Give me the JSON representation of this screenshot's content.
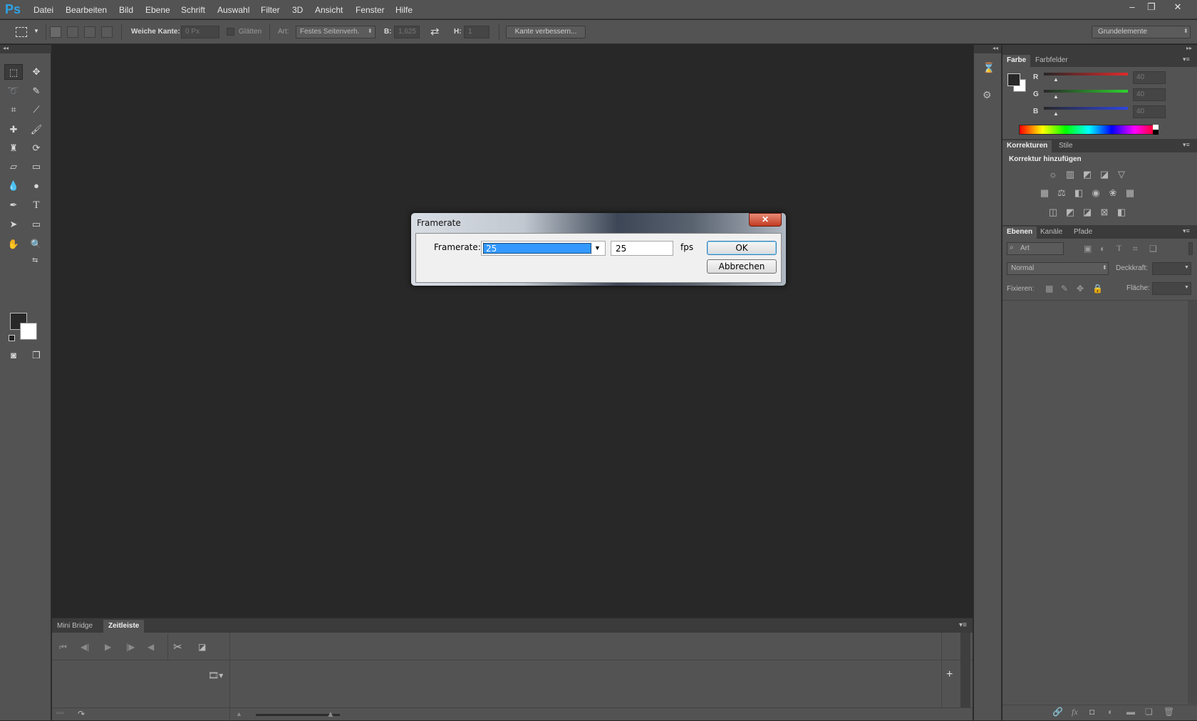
{
  "app": {
    "logo": "Ps"
  },
  "menu": [
    "Datei",
    "Bearbeiten",
    "Bild",
    "Ebene",
    "Schrift",
    "Auswahl",
    "Filter",
    "3D",
    "Ansicht",
    "Fenster",
    "Hilfe"
  ],
  "window_controls": {
    "minimize": "–",
    "restore": "❐",
    "close": "✕"
  },
  "options_bar": {
    "weiche_kante_label": "Weiche Kante:",
    "weiche_kante_value": "0 Px",
    "glaetten_label": "Glätten",
    "art_label": "Art:",
    "art_value": "Festes Seitenverh.",
    "b_label": "B:",
    "b_value": "1,625",
    "h_label": "H:",
    "h_value": "1",
    "kante_button": "Kante verbessern...",
    "workspace_value": "Grundelemente"
  },
  "timeline": {
    "tabs": [
      "Mini Bridge",
      "Zeitleiste"
    ],
    "active_tab": "Zeitleiste"
  },
  "color_panel": {
    "tabs": [
      "Farbe",
      "Farbfelder"
    ],
    "channels": [
      {
        "letter": "R",
        "value": "40",
        "color": "#d83030"
      },
      {
        "letter": "G",
        "value": "40",
        "color": "#2fb62f"
      },
      {
        "letter": "B",
        "value": "40",
        "color": "#3048d8"
      }
    ]
  },
  "adjustments_panel": {
    "tabs": [
      "Korrekturen",
      "Stile"
    ],
    "heading": "Korrektur hinzufügen"
  },
  "layers_panel": {
    "tabs": [
      "Ebenen",
      "Kanäle",
      "Pfade"
    ],
    "filter_value": "Art",
    "blend_mode": "Normal",
    "opacity_label": "Deckkraft:",
    "lock_label": "Fixieren:",
    "fill_label": "Fläche:"
  },
  "dialog": {
    "title": "Framerate",
    "label": "Framerate:",
    "select_value": "25",
    "input_value": "25",
    "unit": "fps",
    "ok": "OK",
    "cancel": "Abbrechen"
  }
}
